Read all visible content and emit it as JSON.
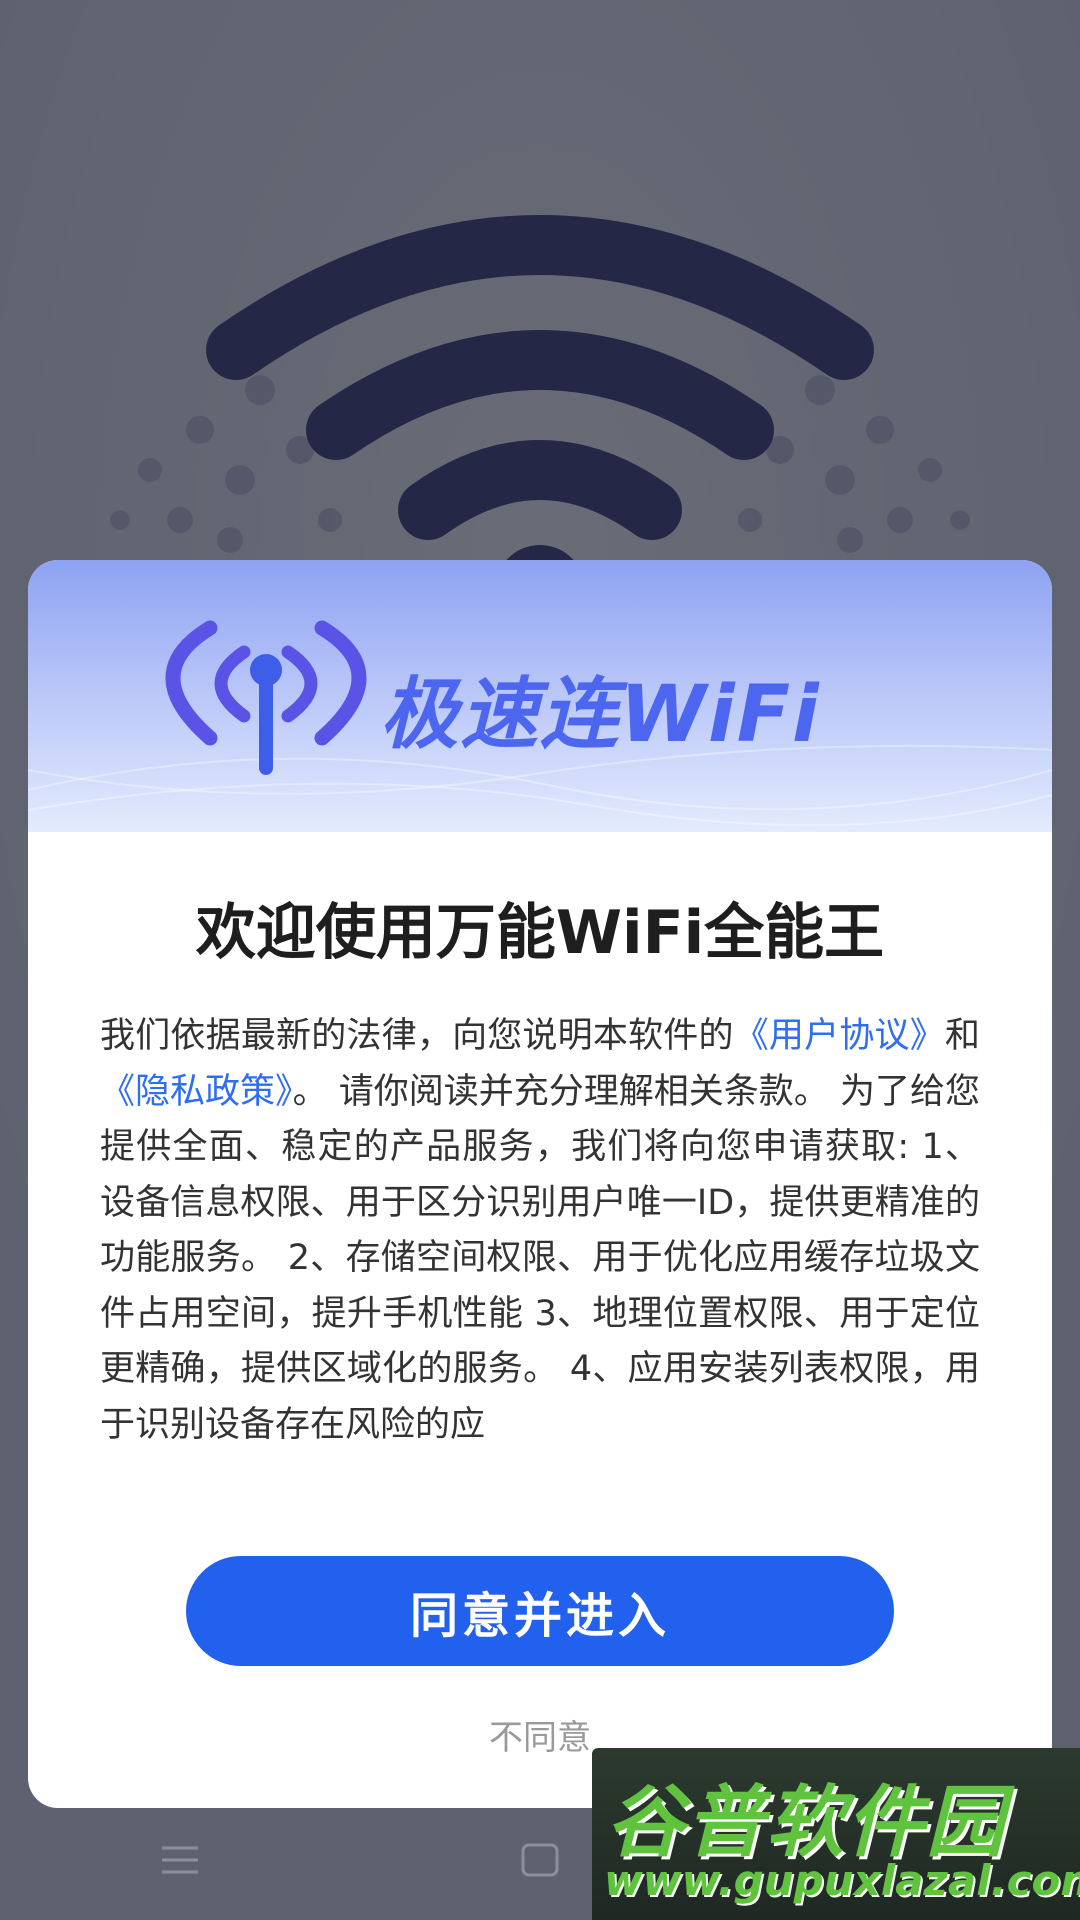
{
  "dialog": {
    "brand": "极速连WiFi",
    "title": "欢迎使用万能WiFi全能王",
    "body": {
      "intro": "我们依据最新的法律，向您说明本软件的",
      "user_agreement": "《用户协议》",
      "and": "和",
      "privacy_policy": "《隐私政策》",
      "rest": "。 请你阅读并充分理解相关条款。 为了给您提供全面、稳定的产品服务，我们将向您申请获取: 1、设备信息权限、用于区分识别用户唯一ID，提供更精准的功能服务。 2、存储空间权限、用于优化应用缓存垃圾文件占用空间，提升手机性能 3、地理位置权限、用于定位更精确，提供区域化的服务。 4、应用安装列表权限，用于识别设备存在风险的应"
    },
    "agree_label": "同意并进入",
    "disagree_label": "不同意"
  },
  "watermark": {
    "title": "谷普软件园",
    "url": "www.gupuxlazal.com"
  },
  "colors": {
    "primary": "#2260ee",
    "link": "#2f6df2",
    "brand": "#4d66f0",
    "watermark_green": "#5fc33d"
  },
  "icons": {
    "background": "wifi-signal-icon",
    "banner": "antenna-signal-icon",
    "nav_menu": "menu-icon",
    "nav_home": "home-icon"
  }
}
